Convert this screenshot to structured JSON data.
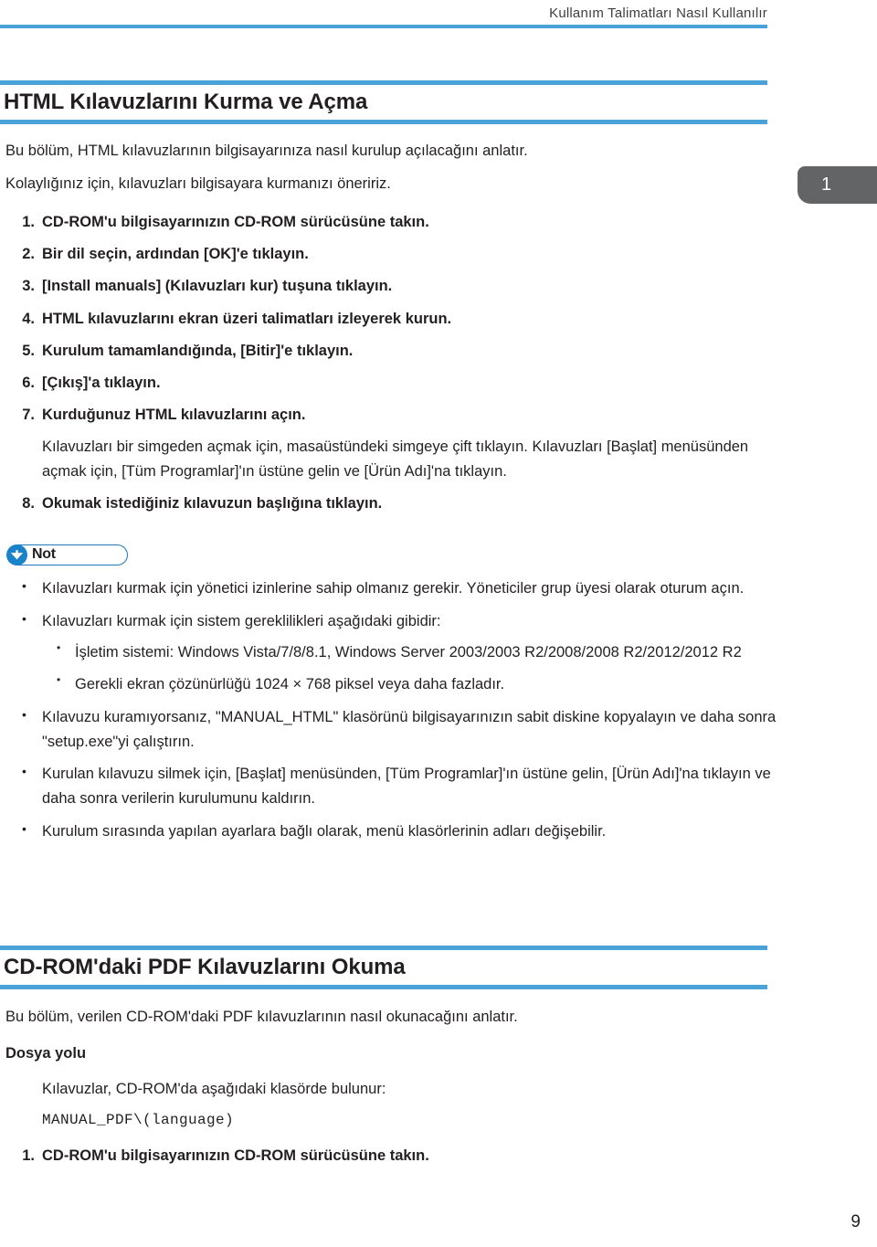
{
  "header": {
    "running_title": "Kullanım Talimatları Nasıl Kullanılır",
    "rule_color": "#4aa3d8"
  },
  "chapter_tab": {
    "number": "1",
    "background": "#636466",
    "text_color": "#ffffff"
  },
  "sections": [
    {
      "title": "HTML Kılavuzlarını Kurma ve Açma",
      "intro": [
        "Bu bölüm, HTML kılavuzlarının bilgisayarınıza nasıl kurulup açılacağını anlatır.",
        "Kolaylığınız için, kılavuzları bilgisayara kurmanızı öneririz."
      ],
      "steps": [
        {
          "num": "1.",
          "text": "CD-ROM'u bilgisayarınızın CD-ROM sürücüsüne takın."
        },
        {
          "num": "2.",
          "text": "Bir dil seçin, ardından [OK]'e tıklayın."
        },
        {
          "num": "3.",
          "text": "[Install manuals] (Kılavuzları kur) tuşuna tıklayın."
        },
        {
          "num": "4.",
          "text": "HTML kılavuzlarını ekran üzeri talimatları izleyerek kurun."
        },
        {
          "num": "5.",
          "text": "Kurulum tamamlandığında, [Bitir]'e tıklayın."
        },
        {
          "num": "6.",
          "text": "[Çıkış]'a tıklayın."
        },
        {
          "num": "7.",
          "text": "Kurduğunuz HTML kılavuzlarını açın.",
          "note": "Kılavuzları bir simgeden açmak için, masaüstündeki simgeye çift tıklayın. Kılavuzları [Başlat] menüsünden açmak için, [Tüm Programlar]'ın üstüne gelin ve [Ürün Adı]'na tıklayın."
        },
        {
          "num": "8.",
          "text": "Okumak istediğiniz kılavuzun başlığına tıklayın."
        }
      ],
      "note_badge": {
        "label": "Not",
        "icon": "down-arrow-in-circle-icon",
        "circle_color": "#1a82c8",
        "border_color": "#1f78bd"
      },
      "notes": [
        {
          "text": "Kılavuzları kurmak için yönetici izinlerine sahip olmanız gerekir. Yöneticiler grup üyesi olarak oturum açın.",
          "children": []
        },
        {
          "text": "Kılavuzları kurmak için sistem gereklilikleri aşağıdaki gibidir:",
          "children": [
            "İşletim sistemi: Windows Vista/7/8/8.1, Windows Server 2003/2003 R2/2008/2008 R2/2012/2012 R2",
            "Gerekli ekran çözünürlüğü 1024 × 768 piksel veya daha fazladır."
          ]
        },
        {
          "text": "Kılavuzu kuramıyorsanız, \"MANUAL_HTML\" klasörünü bilgisayarınızın sabit diskine kopyalayın ve daha sonra \"setup.exe\"yi çalıştırın.",
          "children": []
        },
        {
          "text": "Kurulan kılavuzu silmek için, [Başlat] menüsünden, [Tüm Programlar]'ın üstüne gelin, [Ürün Adı]'na tıklayın ve daha sonra verilerin kurulumunu kaldırın.",
          "children": []
        },
        {
          "text": "Kurulum sırasında yapılan ayarlara bağlı olarak, menü klasörlerinin adları değişebilir.",
          "children": []
        }
      ]
    },
    {
      "title": "CD-ROM'daki PDF Kılavuzlarını Okuma",
      "intro": [
        "Bu bölüm, verilen CD-ROM'daki PDF kılavuzlarının nasıl okunacağını anlatır."
      ],
      "subheading": "Dosya yolu",
      "path_intro": "Kılavuzlar, CD-ROM'da aşağıdaki klasörde bulunur:",
      "path_value": "MANUAL_PDF\\(language)",
      "steps": [
        {
          "num": "1.",
          "text": "CD-ROM'u bilgisayarınızın CD-ROM sürücüsüne takın."
        }
      ]
    }
  ],
  "footer": {
    "page_number": "9"
  }
}
